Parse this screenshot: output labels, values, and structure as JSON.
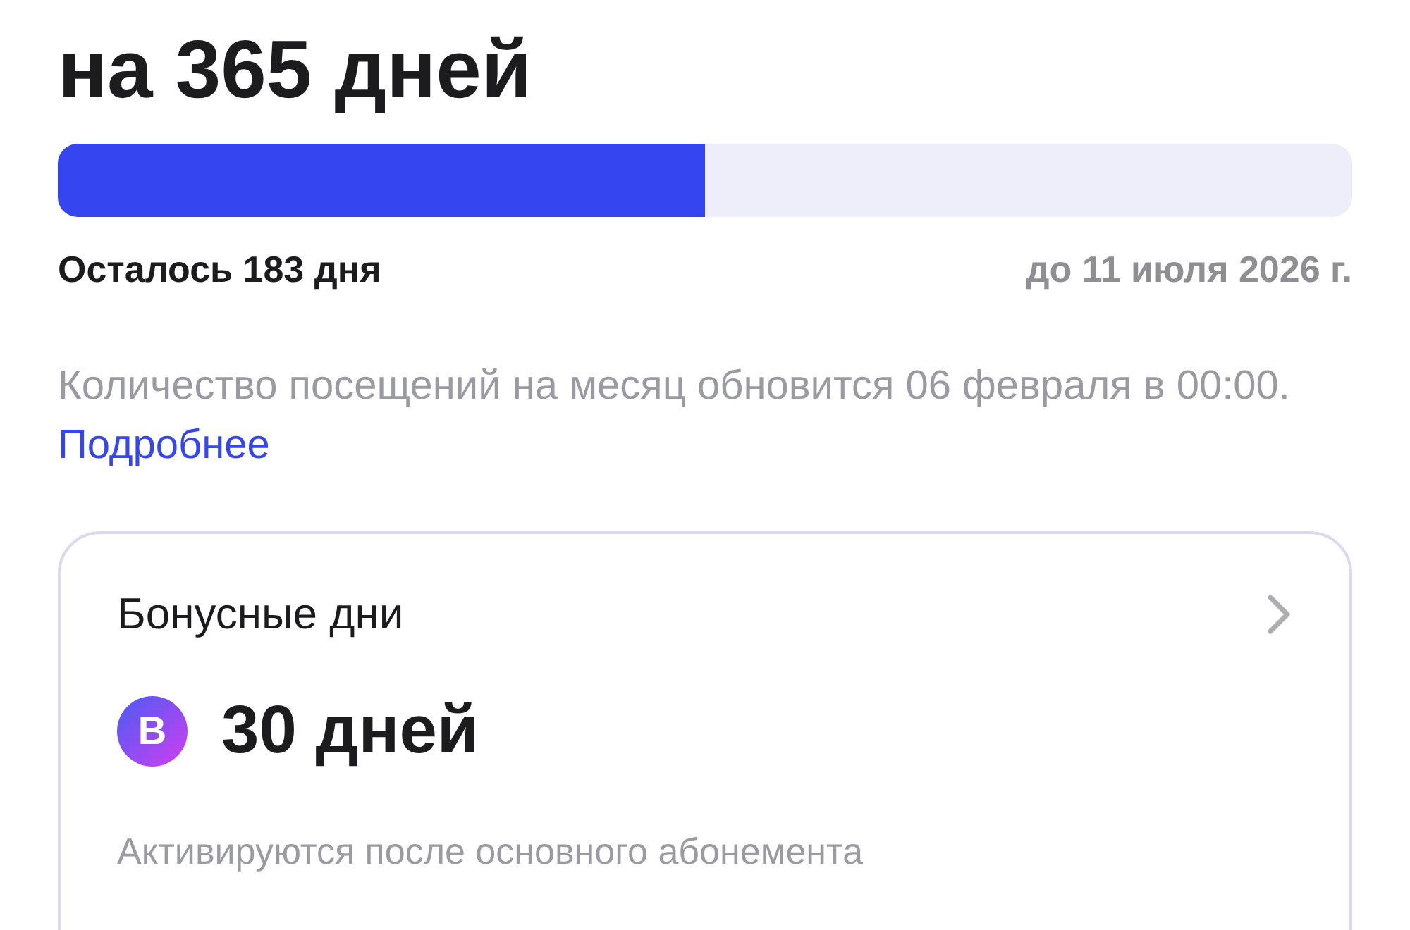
{
  "subscription": {
    "title": "на 365 дней",
    "level": 0.5,
    "remaining": "Осталось 183 дня",
    "until": "до 11 июля 2026 г."
  },
  "notice": {
    "text": "Количество посещений на месяц обновится 06 февраля в 00:00.",
    "link": "Подробнее"
  },
  "bonus_card": {
    "title": "Бонусные дни",
    "badge": "B",
    "days": "30 дней",
    "caption": "Активируются после основного абонемента"
  }
}
